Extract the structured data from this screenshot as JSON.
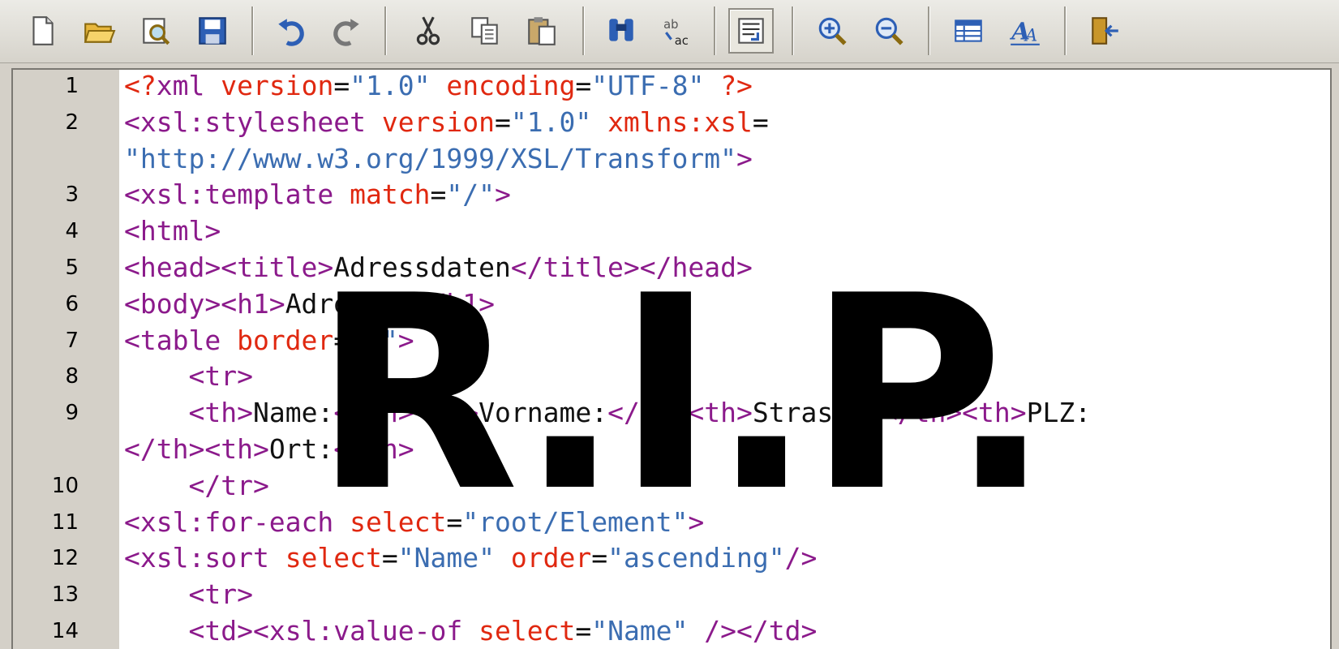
{
  "toolbar": {
    "buttons": [
      {
        "name": "new-file-icon",
        "title": "New"
      },
      {
        "name": "open-folder-icon",
        "title": "Open"
      },
      {
        "name": "preview-icon",
        "title": "Preview"
      },
      {
        "name": "save-icon",
        "title": "Save"
      },
      {
        "name": "undo-icon",
        "title": "Undo"
      },
      {
        "name": "redo-icon",
        "title": "Redo"
      },
      {
        "name": "cut-icon",
        "title": "Cut"
      },
      {
        "name": "copy-icon",
        "title": "Copy"
      },
      {
        "name": "paste-icon",
        "title": "Paste"
      },
      {
        "name": "find-icon",
        "title": "Find"
      },
      {
        "name": "replace-icon",
        "title": "Replace"
      },
      {
        "name": "word-wrap-icon",
        "title": "Word Wrap",
        "active": true
      },
      {
        "name": "zoom-in-icon",
        "title": "Zoom In"
      },
      {
        "name": "zoom-out-icon",
        "title": "Zoom Out"
      },
      {
        "name": "table-icon",
        "title": "Table"
      },
      {
        "name": "font-icon",
        "title": "Font"
      },
      {
        "name": "exit-icon",
        "title": "Exit"
      }
    ]
  },
  "editor": {
    "lines": [
      {
        "num": "1",
        "segments": [
          [
            "pi",
            "<?"
          ],
          [
            "tag",
            "xml "
          ],
          [
            "attr",
            "version"
          ],
          [
            "text",
            "="
          ],
          [
            "val",
            "\"1.0\""
          ],
          [
            "text",
            " "
          ],
          [
            "attr",
            "encoding"
          ],
          [
            "text",
            "="
          ],
          [
            "val",
            "\"UTF-8\""
          ],
          [
            "text",
            " "
          ],
          [
            "pi",
            "?>"
          ]
        ]
      },
      {
        "num": "2",
        "segments": [
          [
            "tag",
            "<xsl:stylesheet "
          ],
          [
            "attr",
            "version"
          ],
          [
            "text",
            "="
          ],
          [
            "val",
            "\"1.0\""
          ],
          [
            "text",
            " "
          ],
          [
            "attr",
            "xmlns:xsl"
          ],
          [
            "text",
            "="
          ]
        ]
      },
      {
        "num": "",
        "segments": [
          [
            "val",
            "\"http://www.w3.org/1999/XSL/Transform\""
          ],
          [
            "tag",
            ">"
          ]
        ]
      },
      {
        "num": "3",
        "segments": [
          [
            "tag",
            "<xsl:template "
          ],
          [
            "attr",
            "match"
          ],
          [
            "text",
            "="
          ],
          [
            "val",
            "\"/\""
          ],
          [
            "tag",
            ">"
          ]
        ]
      },
      {
        "num": "4",
        "segments": [
          [
            "tag",
            "<html>"
          ]
        ]
      },
      {
        "num": "5",
        "segments": [
          [
            "tag",
            "<head><title>"
          ],
          [
            "text",
            "Adressdaten"
          ],
          [
            "tag",
            "</title></head>"
          ]
        ]
      },
      {
        "num": "6",
        "segments": [
          [
            "tag",
            "<body><h1>"
          ],
          [
            "text",
            "Adressen"
          ],
          [
            "tag",
            "</h1>"
          ]
        ]
      },
      {
        "num": "7",
        "segments": [
          [
            "tag",
            "<table "
          ],
          [
            "attr",
            "border"
          ],
          [
            "text",
            "="
          ],
          [
            "val",
            "\"1\""
          ],
          [
            "tag",
            ">"
          ]
        ]
      },
      {
        "num": "8",
        "segments": [
          [
            "text",
            "    "
          ],
          [
            "tag",
            "<tr>"
          ]
        ]
      },
      {
        "num": "9",
        "segments": [
          [
            "text",
            "    "
          ],
          [
            "tag",
            "<th>"
          ],
          [
            "text",
            "Name:"
          ],
          [
            "tag",
            "</th><th>"
          ],
          [
            "text",
            "Vorname:"
          ],
          [
            "tag",
            "</th><th>"
          ],
          [
            "text",
            "Strasse:"
          ],
          [
            "tag",
            "</th><th>"
          ],
          [
            "text",
            "PLZ:"
          ]
        ]
      },
      {
        "num": "",
        "segments": [
          [
            "tag",
            "</th><th>"
          ],
          [
            "text",
            "Ort:"
          ],
          [
            "tag",
            "</th>"
          ]
        ]
      },
      {
        "num": "10",
        "segments": [
          [
            "text",
            "    "
          ],
          [
            "tag",
            "</tr>"
          ]
        ]
      },
      {
        "num": "11",
        "segments": [
          [
            "tag",
            "<xsl:for-each "
          ],
          [
            "attr",
            "select"
          ],
          [
            "text",
            "="
          ],
          [
            "val",
            "\"root/Element\""
          ],
          [
            "tag",
            ">"
          ]
        ]
      },
      {
        "num": "12",
        "segments": [
          [
            "tag",
            "<xsl:sort "
          ],
          [
            "attr",
            "select"
          ],
          [
            "text",
            "="
          ],
          [
            "val",
            "\"Name\""
          ],
          [
            "text",
            " "
          ],
          [
            "attr",
            "order"
          ],
          [
            "text",
            "="
          ],
          [
            "val",
            "\"ascending\""
          ],
          [
            "tag",
            "/>"
          ]
        ]
      },
      {
        "num": "13",
        "segments": [
          [
            "text",
            "    "
          ],
          [
            "tag",
            "<tr>"
          ]
        ]
      },
      {
        "num": "14",
        "segments": [
          [
            "text",
            "    "
          ],
          [
            "tag",
            "<td><xsl:value-of "
          ],
          [
            "attr",
            "select"
          ],
          [
            "text",
            "="
          ],
          [
            "val",
            "\"Name\""
          ],
          [
            "text",
            " "
          ],
          [
            "tag",
            "/></td>"
          ]
        ]
      }
    ]
  },
  "overlay": {
    "text": "R.I.P."
  }
}
